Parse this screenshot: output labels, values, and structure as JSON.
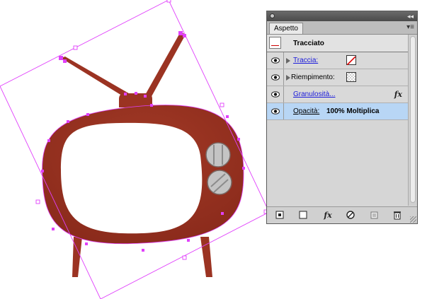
{
  "panel": {
    "tab_label": "Aspetto",
    "collapse_glyph": "◂◂",
    "menu_glyph": "▾≡",
    "header_title": "Tracciato",
    "rows": [
      {
        "label": "Traccia:",
        "swatch": "none-red-slash"
      },
      {
        "label": "Riempimento:",
        "swatch": "checker"
      },
      {
        "label": "Granulosità...",
        "fx": "fx"
      },
      {
        "label": "Opacità:",
        "value": "100% Moltiplica"
      }
    ],
    "toolbar": {
      "fx_glyph": "fx"
    }
  },
  "colors": {
    "tv_body": "#9b3322",
    "selection": "#e040fb",
    "knob": "#c4c4c4",
    "row_selected": "#b8d6f5",
    "link": "#1a1adb"
  },
  "icons": [
    "eye-icon",
    "disclosure-triangle-icon",
    "fx-icon",
    "new-layer-icon",
    "new-item-icon",
    "clear-icon",
    "duplicate-icon",
    "trash-icon"
  ]
}
